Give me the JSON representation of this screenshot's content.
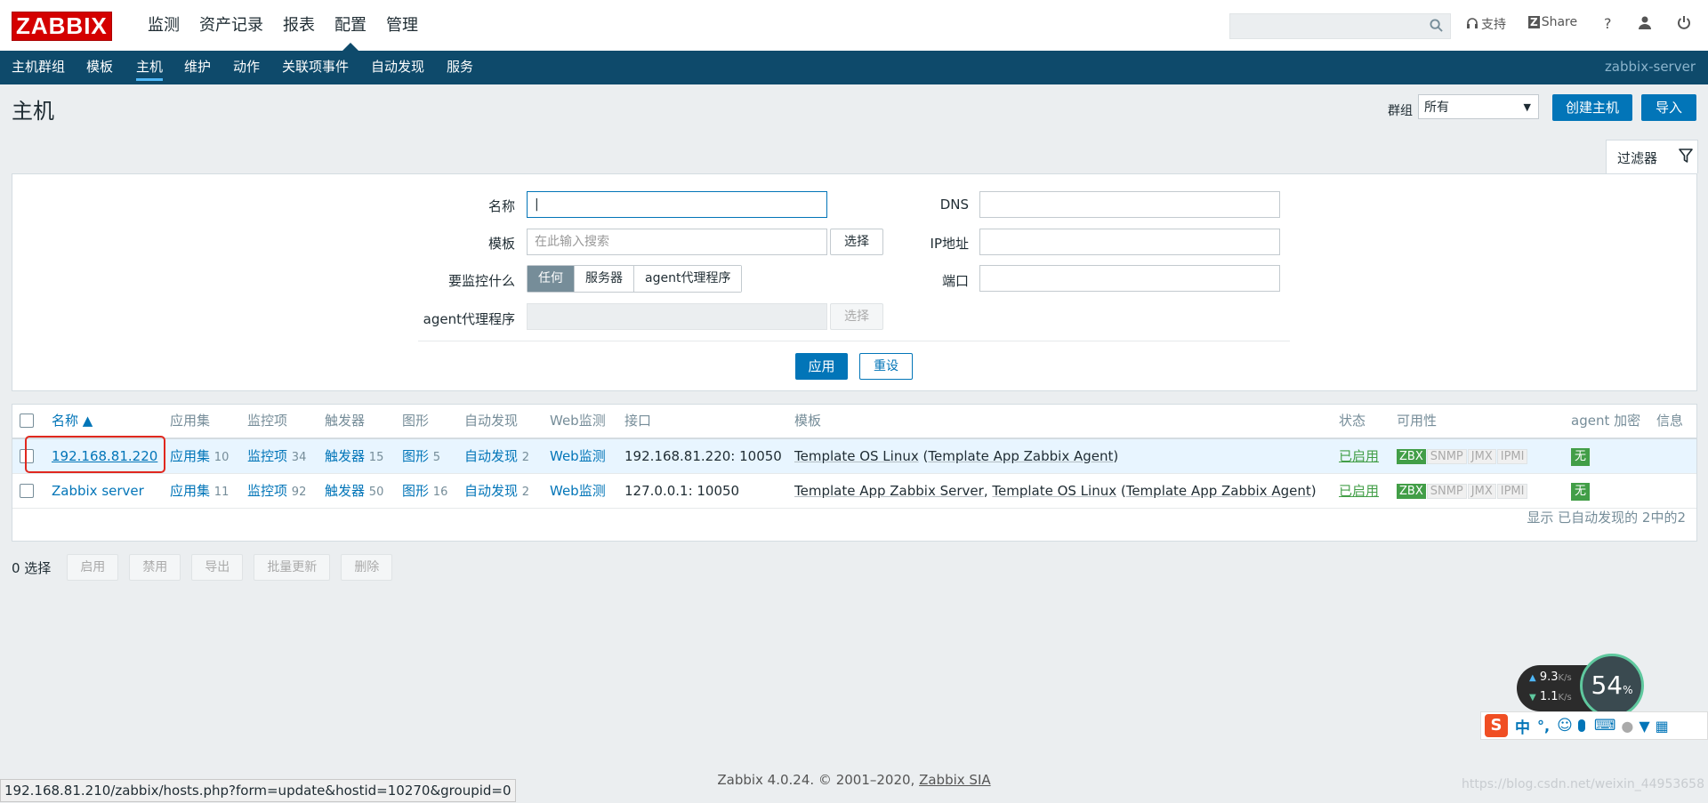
{
  "logo": "ZABBIX",
  "main_nav": [
    "监测",
    "资产记录",
    "报表",
    "配置",
    "管理"
  ],
  "top_right": {
    "support": "支持",
    "share": "Share",
    "help": "?"
  },
  "sub_nav": [
    "主机群组",
    "模板",
    "主机",
    "维护",
    "动作",
    "关联项事件",
    "自动发现",
    "服务"
  ],
  "server_name": "zabbix-server",
  "page_title": "主机",
  "group": {
    "label": "群组",
    "value": "所有"
  },
  "buttons": {
    "create": "创建主机",
    "import": "导入"
  },
  "filter": {
    "tab": "过滤器",
    "name_label": "名称",
    "template_label": "模板",
    "template_placeholder": "在此输入搜索",
    "select": "选择",
    "monitor_label": "要监控什么",
    "monitor_options": [
      "任何",
      "服务器",
      "agent代理程序"
    ],
    "proxy_label": "agent代理程序",
    "dns_label": "DNS",
    "ip_label": "IP地址",
    "port_label": "端口",
    "apply": "应用",
    "reset": "重设"
  },
  "table": {
    "headers": [
      "名称 ▲",
      "应用集",
      "监控项",
      "触发器",
      "图形",
      "自动发现",
      "Web监测",
      "接口",
      "模板",
      "状态",
      "可用性",
      "agent 加密",
      "信息"
    ],
    "rows": [
      {
        "name": "192.168.81.220",
        "apps": "应用集",
        "apps_n": "10",
        "items": "监控项",
        "items_n": "34",
        "triggers": "触发器",
        "triggers_n": "15",
        "graphs": "图形",
        "graphs_n": "5",
        "discovery": "自动发现",
        "discovery_n": "2",
        "web": "Web监测",
        "interface": "192.168.81.220: 10050",
        "tmpl_a": "Template OS Linux",
        "tmpl_b": "",
        "tmpl_paren": "Template App Zabbix Agent",
        "status": "已启用",
        "avail": [
          "ZBX",
          "SNMP",
          "JMX",
          "IPMI"
        ],
        "encryption": "无"
      },
      {
        "name": "Zabbix server",
        "apps": "应用集",
        "apps_n": "11",
        "items": "监控项",
        "items_n": "92",
        "triggers": "触发器",
        "triggers_n": "50",
        "graphs": "图形",
        "graphs_n": "16",
        "discovery": "自动发现",
        "discovery_n": "2",
        "web": "Web监测",
        "interface": "127.0.0.1: 10050",
        "tmpl_a": "Template App Zabbix Server",
        "tmpl_b": "Template OS Linux",
        "tmpl_paren": "Template App Zabbix Agent",
        "status": "已启用",
        "avail": [
          "ZBX",
          "SNMP",
          "JMX",
          "IPMI"
        ],
        "encryption": "无"
      }
    ],
    "footer": "显示 已自动发现的 2中的2"
  },
  "actions": {
    "selected": "0 选择",
    "buttons": [
      "启用",
      "禁用",
      "导出",
      "批量更新",
      "删除"
    ]
  },
  "copyright_text": "Zabbix 4.0.24. © 2001–2020, ",
  "copyright_link": "Zabbix SIA",
  "status_url": "192.168.81.210/zabbix/hosts.php?form=update&hostid=10270&groupid=0",
  "watermark": "https://blog.csdn.net/weixin_44953658",
  "net_widget": {
    "up": "9.3",
    "down": "1.1",
    "unit": "K/s",
    "percent": "54",
    "percent_sign": "%"
  },
  "ime_label": "中",
  "colors": {
    "nav_bg": "#0e4a6b",
    "accent": "#0275b8",
    "enabled": "#429e47",
    "logo": "#d40000"
  }
}
